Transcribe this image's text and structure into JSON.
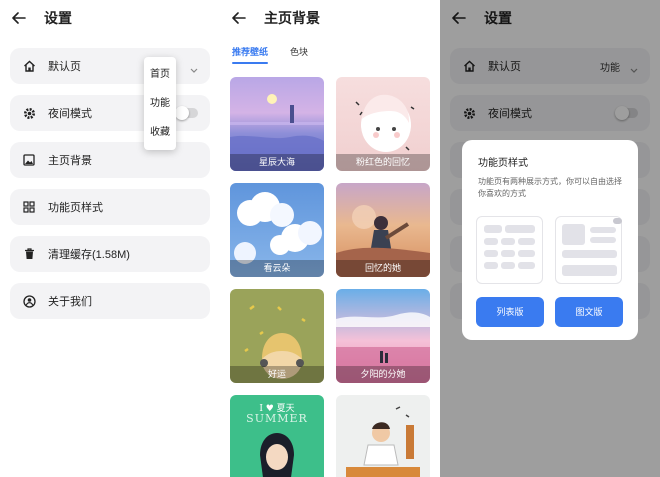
{
  "settings": {
    "title": "设置",
    "items": [
      {
        "label": "默认页"
      },
      {
        "label": "夜间模式"
      },
      {
        "label": "主页背景"
      },
      {
        "label": "功能页样式"
      },
      {
        "label": "清理缓存(1.58M)"
      },
      {
        "label": "关于我们"
      }
    ],
    "dropdown": [
      "首页",
      "功能",
      "收藏"
    ]
  },
  "background": {
    "title": "主页背景",
    "tabs": [
      "推荐壁纸",
      "色块"
    ],
    "active_tab": "推荐壁纸",
    "wallpapers": [
      {
        "caption": "星辰大海"
      },
      {
        "caption": "粉红色的回忆"
      },
      {
        "caption": "看云朵"
      },
      {
        "caption": "回忆的她"
      },
      {
        "caption": "好运"
      },
      {
        "caption": "夕阳的分她"
      },
      {
        "caption": "",
        "art_text": [
          "I ♥ 夏天",
          "SUMMER"
        ]
      },
      {
        "caption": ""
      }
    ]
  },
  "settings_dialog": {
    "title": "设置",
    "default_page_value": "功能",
    "dialog": {
      "title": "功能页样式",
      "description": "功能页有两种展示方式，你可以自由选择你喜欢的方式",
      "buttons": [
        "列表版",
        "图文版"
      ]
    }
  },
  "colors": {
    "accent": "#3a7bf0",
    "card_bg": "#f3f3f5"
  }
}
